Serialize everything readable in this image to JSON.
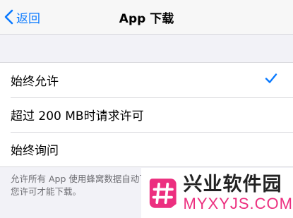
{
  "nav": {
    "back_label": "返回",
    "title": "App 下载"
  },
  "options": [
    {
      "label": "始终允许",
      "selected": true
    },
    {
      "label": "超过 200 MB时请求许可",
      "selected": false
    },
    {
      "label": "始终询问",
      "selected": false
    }
  ],
  "footer_text": "允许所有 App 使用蜂窝数据自动下载。如果超过 200 MB，将需要您许可才能下载。",
  "watermark": {
    "brand": "兴业软件园",
    "url": "MYXYJS.COM"
  },
  "colors": {
    "accent": "#0a7aff",
    "watermark_pink": "#ec2f7f"
  }
}
